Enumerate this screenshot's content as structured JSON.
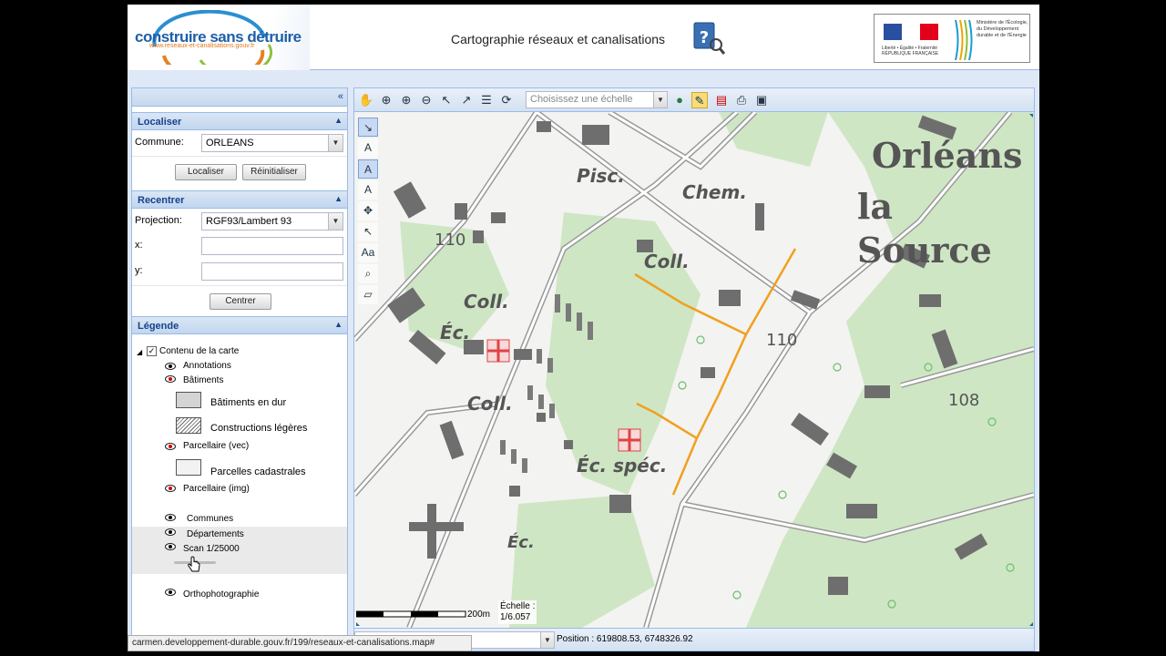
{
  "header": {
    "logo_main": "construire sans détruire",
    "logo_sub": "www.reseaux-et-canalisations.gouv.fr",
    "title": "Cartographie réseaux et canalisations",
    "ministry_rf": "Liberté • Égalité • Fraternité RÉPUBLIQUE FRANÇAISE",
    "ministry_name": "Ministère de l'Écologie, du Développement durable et de l'Énergie"
  },
  "localiser": {
    "title": "Localiser",
    "commune_label": "Commune:",
    "commune_value": "ORLEANS",
    "btn_localiser": "Localiser",
    "btn_reinit": "Réinitialiser"
  },
  "recentrer": {
    "title": "Recentrer",
    "projection_label": "Projection:",
    "projection_value": "RGF93/Lambert 93",
    "x_label": "x:",
    "y_label": "y:",
    "btn_centrer": "Centrer"
  },
  "legende": {
    "title": "Légende",
    "root": "Contenu de la carte",
    "annotations": "Annotations",
    "batiments": "Bâtiments",
    "bat_dur": "Bâtiments en dur",
    "constr_leg": "Constructions légères",
    "parcellaire_vec": "Parcellaire (vec)",
    "parcelles_cad": "Parcelles cadastrales",
    "parcellaire_img": "Parcellaire (img)",
    "communes": "Communes",
    "departements": "Départements",
    "scan": "Scan 1/25000",
    "ortho": "Orthophotographie"
  },
  "toolbar": {
    "scale_placeholder": "Choisissez une échelle"
  },
  "map": {
    "labels": {
      "pisc": "Pisc.",
      "chem": "Chem.",
      "coll1": "Coll.",
      "coll2": "Coll.",
      "coll3": "Coll.",
      "ec1": "Éc.",
      "ec_spec": "Éc. spéc.",
      "ec2": "Éc.",
      "alt110a": "110",
      "alt110b": "110",
      "alt108": "108",
      "town1": "Orléans",
      "town2": "la Source"
    },
    "scale_text": "200m",
    "echelle_label": "Échelle :",
    "echelle_value": "1/6.057"
  },
  "status": {
    "position": "Position : 619808.53, 6748326.92"
  },
  "browser": {
    "url": "carmen.developpement-durable.gouv.fr/199/reseaux-et-canalisations.map#"
  },
  "colors": {
    "panel_border": "#99bbe8",
    "header_text": "#15428b",
    "map_green": "#cfe6c4",
    "pipeline": "#f0a020"
  }
}
